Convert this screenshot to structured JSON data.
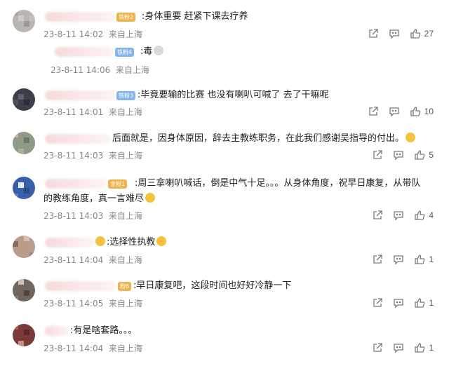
{
  "comments": [
    {
      "badge": "铁粉2",
      "text": ":身体重要  赶紧下课去疗养",
      "time": "23-8-11 14:02",
      "location": "来自上海",
      "likes": "27",
      "reply": {
        "badge": "铁粉4",
        "text": ":毒",
        "time": "23-8-11 14:06",
        "location": "来自上海"
      }
    },
    {
      "badge": "铁粉3",
      "text": ":毕竟要输的比赛  也没有喇叭可喊了  去了干嘛呢",
      "time": "23-8-11 14:01",
      "location": "来自上海",
      "likes": "10"
    },
    {
      "badge": "",
      "text": "后面就是，因身体原因，辞去主教练职务，在此我们感谢吴指导的付出。",
      "time": "23-8-11 14:03",
      "location": "来自上海",
      "likes": "5"
    },
    {
      "badge": "金粉1",
      "text": ":周三拿喇叭喊话，倒是中气十足。。。从身体角度，祝早日康复，从带队",
      "text2": "的教练角度，真一言难尽",
      "time": "23-8-11 14:03",
      "location": "来自上海",
      "likes": "4"
    },
    {
      "badge": "",
      "text": ":选择性执教",
      "time": "23-8-11 14:04",
      "location": "来自上海",
      "likes": "1"
    },
    {
      "badge": "粉6",
      "text": ":早日康复吧，这段时间也好好冷静一下",
      "time": "23-8-11 14:05",
      "location": "来自上海",
      "likes": "1"
    },
    {
      "badge": "",
      "text": ":有是啥套路。。。",
      "time": "23-8-11 14:04",
      "location": "来自上海",
      "likes": "1"
    }
  ]
}
